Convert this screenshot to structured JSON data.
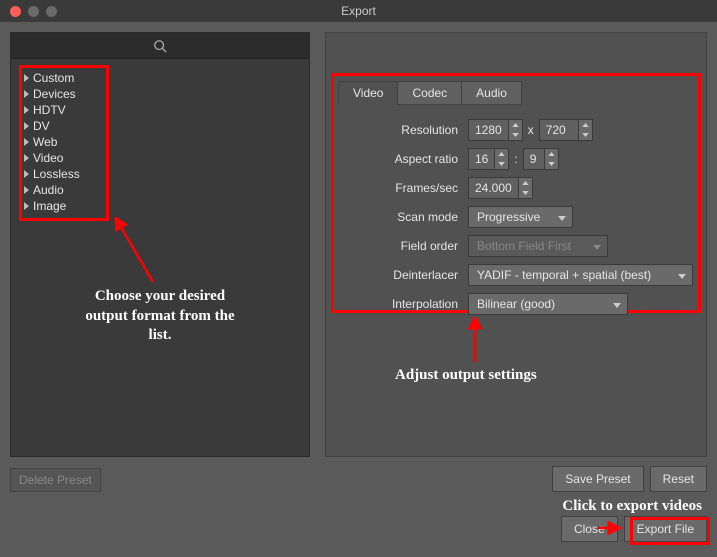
{
  "window": {
    "title": "Export"
  },
  "sidebar": {
    "items": [
      {
        "label": "Custom"
      },
      {
        "label": "Devices"
      },
      {
        "label": "HDTV"
      },
      {
        "label": "DV"
      },
      {
        "label": "Web"
      },
      {
        "label": "Video"
      },
      {
        "label": "Lossless"
      },
      {
        "label": "Audio"
      },
      {
        "label": "Image"
      }
    ]
  },
  "annotations": {
    "left": "Choose your desired output format from the list.",
    "right": "Adjust output settings",
    "export": "Click to export videos"
  },
  "tabs": {
    "video": "Video",
    "codec": "Codec",
    "audio": "Audio"
  },
  "settings": {
    "resolution_label": "Resolution",
    "res_w": "1280",
    "res_h": "720",
    "x_sep": "x",
    "aspect_label": "Aspect ratio",
    "aspect_w": "16",
    "aspect_h": "9",
    "aspect_sep": ":",
    "fps_label": "Frames/sec",
    "fps": "24.000",
    "scan_label": "Scan mode",
    "scan": "Progressive",
    "field_label": "Field order",
    "field": "Bottom Field First",
    "deint_label": "Deinterlacer",
    "deint": "YADIF - temporal + spatial (best)",
    "interp_label": "Interpolation",
    "interp": "Bilinear (good)"
  },
  "buttons": {
    "delete_preset": "Delete Preset",
    "save_preset": "Save Preset",
    "reset": "Reset",
    "close": "Close",
    "export_file": "Export File"
  }
}
